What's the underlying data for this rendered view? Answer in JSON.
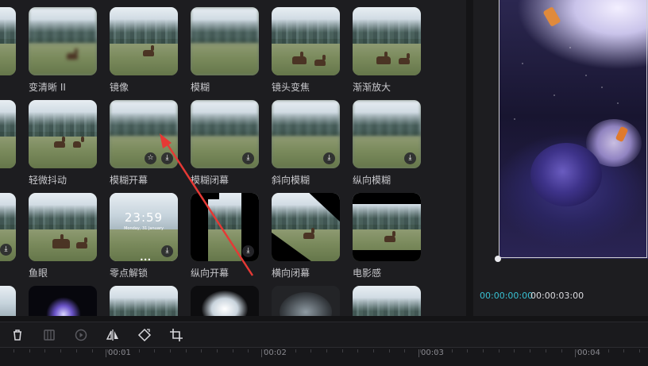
{
  "effects": {
    "row1": [
      {
        "label": "变清晰 II"
      },
      {
        "label": "镜像"
      },
      {
        "label": "模糊"
      },
      {
        "label": "镜头变焦"
      },
      {
        "label": "渐渐放大"
      }
    ],
    "row2": [
      {
        "label": "轻微抖动"
      },
      {
        "label": "模糊开幕"
      },
      {
        "label": "模糊闭幕"
      },
      {
        "label": "斜向模糊"
      },
      {
        "label": "纵向模糊"
      }
    ],
    "row3": [
      {
        "label": "鱼眼"
      },
      {
        "label": "零点解锁"
      },
      {
        "label": "纵向开幕"
      },
      {
        "label": "横向闭幕"
      },
      {
        "label": "电影感"
      }
    ],
    "lock_preview": {
      "time": "23:59",
      "date": "Monday, 31 January"
    },
    "download_icon": "download-icon",
    "favorite_icon": "star-icon"
  },
  "preview": {
    "current_time": "00:00:00:00",
    "total_time": "00:00:03:00"
  },
  "toolbar": {
    "tools": [
      "trash-icon",
      "freeze-frame-icon",
      "play-circle-icon",
      "mirror-icon",
      "rotate-icon",
      "crop-icon"
    ]
  },
  "timeline": {
    "ticks": [
      "00:01",
      "00:02",
      "00:03",
      "00:04"
    ]
  },
  "annotation": {
    "arrow_color": "#e53935"
  }
}
